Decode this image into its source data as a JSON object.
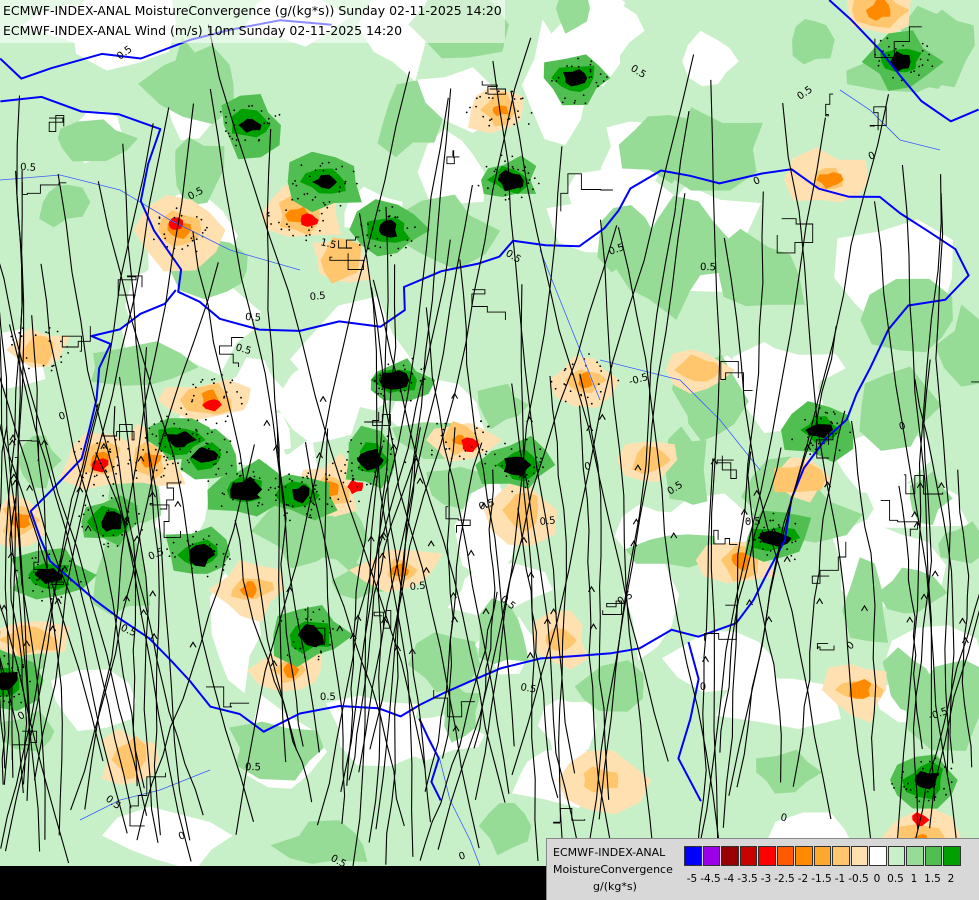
{
  "header": {
    "line1": "ECMWF-INDEX-ANAL MoistureConvergence (g/(kg*s)) Sunday 02-11-2025 14:20",
    "line2": "ECMWF-INDEX-ANAL Wind (m/s) 10m Sunday 02-11-2025 14:20"
  },
  "legend": {
    "title_line1": "ECMWF-INDEX-ANAL",
    "title_line2": "MoistureConvergence",
    "units": "g/(kg*s)",
    "ticks": [
      "-5",
      "-4.5",
      "-4",
      "-3.5",
      "-3",
      "-2.5",
      "-2",
      "-1.5",
      "-1",
      "-0.5",
      "0",
      "0.5",
      "1",
      "1.5",
      "2"
    ],
    "colors": [
      "#0000ff",
      "#9b00e6",
      "#9b0000",
      "#c80000",
      "#ff0000",
      "#ff5a00",
      "#ff8a00",
      "#ffa830",
      "#ffc66e",
      "#ffe0b0",
      "#ffffff",
      "#c8f0c8",
      "#96dc96",
      "#50be50",
      "#00a000"
    ]
  },
  "map": {
    "contour_labels": [
      "0",
      "0.5",
      "-0.5",
      "1.5"
    ],
    "field_colors": {
      "background": "#c8f0c8",
      "neutral": "#ffffff",
      "green_mid": "#96dc96",
      "green_dark": "#50be50",
      "green_strong": "#00a000",
      "extreme": "#000000",
      "orange_light": "#ffe0b0",
      "orange": "#ffc66e",
      "orange_dark": "#ff8a00",
      "red": "#ff0000",
      "border_line": "#0000ff",
      "river_line": "#3a5cff"
    }
  }
}
